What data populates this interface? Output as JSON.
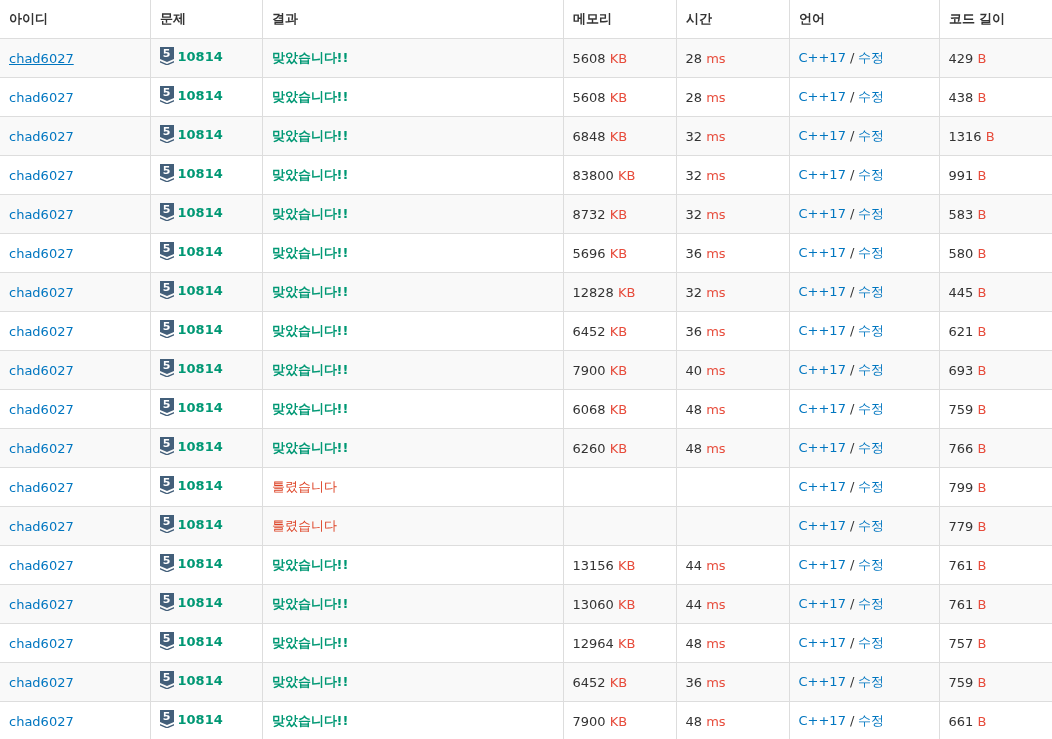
{
  "columns": [
    "아이디",
    "문제",
    "결과",
    "메모리",
    "시간",
    "언어",
    "코드 길이"
  ],
  "rows": [
    {
      "user": "chad6027",
      "hovered": true,
      "tier": "5",
      "problem": "10814",
      "result": "맞았습니다!!",
      "kind": "accepted",
      "memory": "5608",
      "memory_unit": "KB",
      "time": "28",
      "time_unit": "ms",
      "language": "C++17",
      "separator": "/",
      "edit": "수정",
      "length": "429",
      "length_unit": "B"
    },
    {
      "user": "chad6027",
      "hovered": false,
      "tier": "5",
      "problem": "10814",
      "result": "맞았습니다!!",
      "kind": "accepted",
      "memory": "5608",
      "memory_unit": "KB",
      "time": "28",
      "time_unit": "ms",
      "language": "C++17",
      "separator": "/",
      "edit": "수정",
      "length": "438",
      "length_unit": "B"
    },
    {
      "user": "chad6027",
      "hovered": false,
      "tier": "5",
      "problem": "10814",
      "result": "맞았습니다!!",
      "kind": "accepted",
      "memory": "6848",
      "memory_unit": "KB",
      "time": "32",
      "time_unit": "ms",
      "language": "C++17",
      "separator": "/",
      "edit": "수정",
      "length": "1316",
      "length_unit": "B"
    },
    {
      "user": "chad6027",
      "hovered": false,
      "tier": "5",
      "problem": "10814",
      "result": "맞았습니다!!",
      "kind": "accepted",
      "memory": "83800",
      "memory_unit": "KB",
      "time": "32",
      "time_unit": "ms",
      "language": "C++17",
      "separator": "/",
      "edit": "수정",
      "length": "991",
      "length_unit": "B"
    },
    {
      "user": "chad6027",
      "hovered": false,
      "tier": "5",
      "problem": "10814",
      "result": "맞았습니다!!",
      "kind": "accepted",
      "memory": "8732",
      "memory_unit": "KB",
      "time": "32",
      "time_unit": "ms",
      "language": "C++17",
      "separator": "/",
      "edit": "수정",
      "length": "583",
      "length_unit": "B"
    },
    {
      "user": "chad6027",
      "hovered": false,
      "tier": "5",
      "problem": "10814",
      "result": "맞았습니다!!",
      "kind": "accepted",
      "memory": "5696",
      "memory_unit": "KB",
      "time": "36",
      "time_unit": "ms",
      "language": "C++17",
      "separator": "/",
      "edit": "수정",
      "length": "580",
      "length_unit": "B"
    },
    {
      "user": "chad6027",
      "hovered": false,
      "tier": "5",
      "problem": "10814",
      "result": "맞았습니다!!",
      "kind": "accepted",
      "memory": "12828",
      "memory_unit": "KB",
      "time": "32",
      "time_unit": "ms",
      "language": "C++17",
      "separator": "/",
      "edit": "수정",
      "length": "445",
      "length_unit": "B"
    },
    {
      "user": "chad6027",
      "hovered": false,
      "tier": "5",
      "problem": "10814",
      "result": "맞았습니다!!",
      "kind": "accepted",
      "memory": "6452",
      "memory_unit": "KB",
      "time": "36",
      "time_unit": "ms",
      "language": "C++17",
      "separator": "/",
      "edit": "수정",
      "length": "621",
      "length_unit": "B"
    },
    {
      "user": "chad6027",
      "hovered": false,
      "tier": "5",
      "problem": "10814",
      "result": "맞았습니다!!",
      "kind": "accepted",
      "memory": "7900",
      "memory_unit": "KB",
      "time": "40",
      "time_unit": "ms",
      "language": "C++17",
      "separator": "/",
      "edit": "수정",
      "length": "693",
      "length_unit": "B"
    },
    {
      "user": "chad6027",
      "hovered": false,
      "tier": "5",
      "problem": "10814",
      "result": "맞았습니다!!",
      "kind": "accepted",
      "memory": "6068",
      "memory_unit": "KB",
      "time": "48",
      "time_unit": "ms",
      "language": "C++17",
      "separator": "/",
      "edit": "수정",
      "length": "759",
      "length_unit": "B"
    },
    {
      "user": "chad6027",
      "hovered": false,
      "tier": "5",
      "problem": "10814",
      "result": "맞았습니다!!",
      "kind": "accepted",
      "memory": "6260",
      "memory_unit": "KB",
      "time": "48",
      "time_unit": "ms",
      "language": "C++17",
      "separator": "/",
      "edit": "수정",
      "length": "766",
      "length_unit": "B"
    },
    {
      "user": "chad6027",
      "hovered": false,
      "tier": "5",
      "problem": "10814",
      "result": "틀렸습니다",
      "kind": "wrong",
      "language": "C++17",
      "separator": "/",
      "edit": "수정",
      "length": "799",
      "length_unit": "B"
    },
    {
      "user": "chad6027",
      "hovered": false,
      "tier": "5",
      "problem": "10814",
      "result": "틀렸습니다",
      "kind": "wrong",
      "language": "C++17",
      "separator": "/",
      "edit": "수정",
      "length": "779",
      "length_unit": "B"
    },
    {
      "user": "chad6027",
      "hovered": false,
      "tier": "5",
      "problem": "10814",
      "result": "맞았습니다!!",
      "kind": "accepted",
      "memory": "13156",
      "memory_unit": "KB",
      "time": "44",
      "time_unit": "ms",
      "language": "C++17",
      "separator": "/",
      "edit": "수정",
      "length": "761",
      "length_unit": "B"
    },
    {
      "user": "chad6027",
      "hovered": false,
      "tier": "5",
      "problem": "10814",
      "result": "맞았습니다!!",
      "kind": "accepted",
      "memory": "13060",
      "memory_unit": "KB",
      "time": "44",
      "time_unit": "ms",
      "language": "C++17",
      "separator": "/",
      "edit": "수정",
      "length": "761",
      "length_unit": "B"
    },
    {
      "user": "chad6027",
      "hovered": false,
      "tier": "5",
      "problem": "10814",
      "result": "맞았습니다!!",
      "kind": "accepted",
      "memory": "12964",
      "memory_unit": "KB",
      "time": "48",
      "time_unit": "ms",
      "language": "C++17",
      "separator": "/",
      "edit": "수정",
      "length": "757",
      "length_unit": "B"
    },
    {
      "user": "chad6027",
      "hovered": false,
      "tier": "5",
      "problem": "10814",
      "result": "맞았습니다!!",
      "kind": "accepted",
      "memory": "6452",
      "memory_unit": "KB",
      "time": "36",
      "time_unit": "ms",
      "language": "C++17",
      "separator": "/",
      "edit": "수정",
      "length": "759",
      "length_unit": "B"
    },
    {
      "user": "chad6027",
      "hovered": false,
      "tier": "5",
      "problem": "10814",
      "result": "맞았습니다!!",
      "kind": "accepted",
      "memory": "7900",
      "memory_unit": "KB",
      "time": "48",
      "time_unit": "ms",
      "language": "C++17",
      "separator": "/",
      "edit": "수정",
      "length": "661",
      "length_unit": "B"
    }
  ]
}
